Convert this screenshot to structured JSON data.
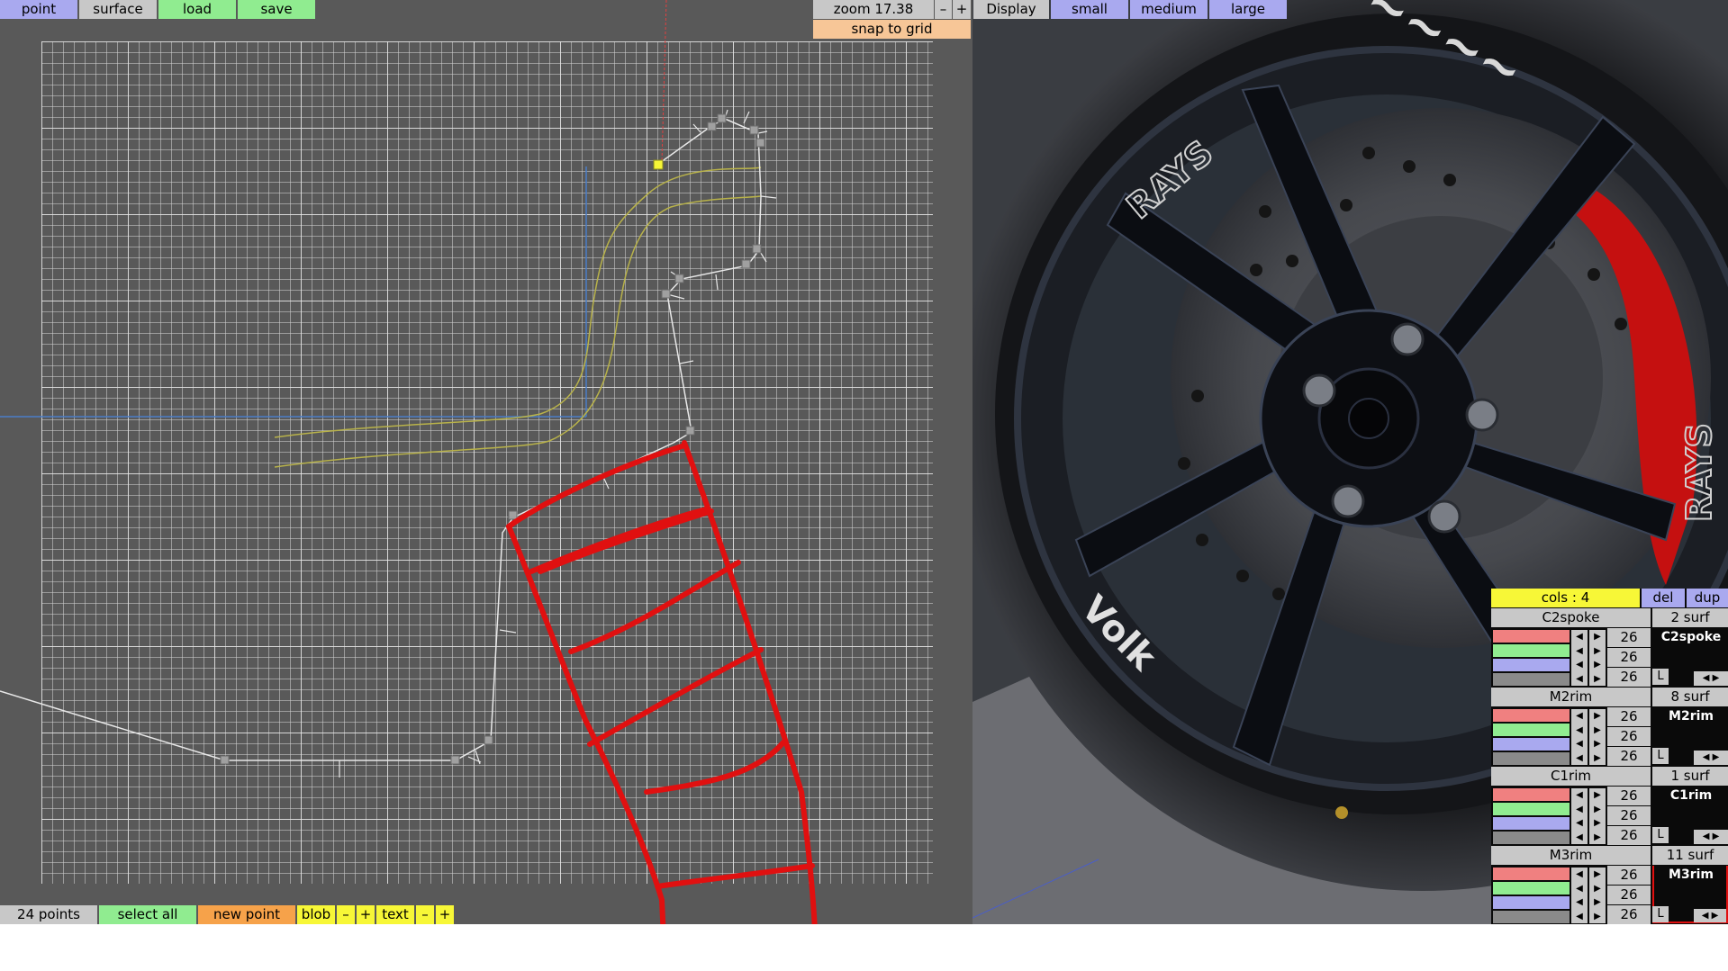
{
  "toolbar": {
    "point": "point",
    "surface": "surface",
    "load": "load",
    "save": "save"
  },
  "view_controls": {
    "zoom_label": "zoom 17.38",
    "zoom_minus": "–",
    "zoom_plus": "+",
    "display": "Display",
    "small": "small",
    "medium": "medium",
    "large": "large",
    "snap_to_grid": "snap to grid"
  },
  "status_bar": {
    "points_count": "24 points",
    "select_all": "select all",
    "new_point": "new point",
    "blob": "blob",
    "blob_minus": "–",
    "blob_plus": "+",
    "text": "text",
    "text_minus": "–",
    "text_plus": "+"
  },
  "surface_panel": {
    "cols_label": "cols : 4",
    "del": "del",
    "dup": "dup",
    "groups": [
      {
        "name": "C2spoke",
        "surf": "2 surf",
        "preview": "C2spoke",
        "values": [
          "26",
          "26",
          "26"
        ],
        "lock": "L"
      },
      {
        "name": "M2rim",
        "surf": "8 surf",
        "preview": "M2rim",
        "values": [
          "26",
          "26",
          "26"
        ],
        "lock": "L"
      },
      {
        "name": "C1rim",
        "surf": "1 surf",
        "preview": "C1rim",
        "values": [
          "26",
          "26",
          "26"
        ],
        "lock": "L"
      },
      {
        "name": "M3rim",
        "surf": "11 surf",
        "preview": "M3rim",
        "values": [
          "26",
          "26",
          "26"
        ],
        "lock": "L"
      }
    ]
  },
  "wheel_text": {
    "rays_top": "RAYS",
    "rays_right": "RAYS",
    "volk": "Volk"
  },
  "colors": {
    "toolbar_blue": "#a9a9ef",
    "toolbar_grey": "#c8c8c8",
    "toolbar_green": "#90ec90",
    "status_orange": "#f6a24a",
    "snap_orange": "#f7c697",
    "yellow": "#f7f737",
    "red_sketch": "#e01010",
    "channel_red": "#f08080",
    "channel_green": "#90ec90",
    "channel_blue": "#a9a9ef"
  }
}
